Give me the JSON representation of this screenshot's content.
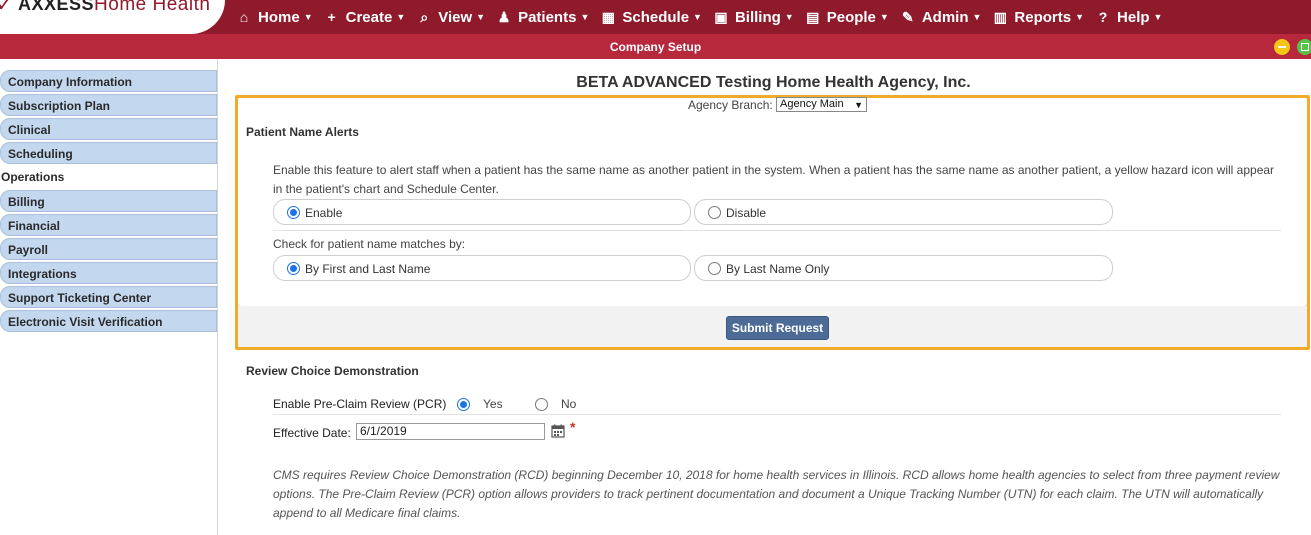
{
  "app": {
    "brand_bold": "AXXESS",
    "brand_light": "Home Health"
  },
  "nav": [
    {
      "label": "Home",
      "icon": "home-icon",
      "glyph": "⌂"
    },
    {
      "label": "Create",
      "icon": "plus-icon",
      "glyph": "+"
    },
    {
      "label": "View",
      "icon": "search-icon",
      "glyph": "⌕"
    },
    {
      "label": "Patients",
      "icon": "user-icon",
      "glyph": "♟"
    },
    {
      "label": "Schedule",
      "icon": "calendar-icon",
      "glyph": "▦"
    },
    {
      "label": "Billing",
      "icon": "money-icon",
      "glyph": "▣"
    },
    {
      "label": "People",
      "icon": "id-card-icon",
      "glyph": "▤"
    },
    {
      "label": "Admin",
      "icon": "wrench-icon",
      "glyph": "✎"
    },
    {
      "label": "Reports",
      "icon": "bar-chart-icon",
      "glyph": "▥"
    },
    {
      "label": "Help",
      "icon": "question-icon",
      "glyph": "?"
    }
  ],
  "window": {
    "title": "Company Setup"
  },
  "sidebar": {
    "items": [
      {
        "label": "Company Information",
        "active": false
      },
      {
        "label": "Subscription Plan",
        "active": false
      },
      {
        "label": "Clinical",
        "active": false
      },
      {
        "label": "Scheduling",
        "active": false
      },
      {
        "label": "Operations",
        "active": true
      },
      {
        "label": "Billing",
        "active": false
      },
      {
        "label": "Financial",
        "active": false
      },
      {
        "label": "Payroll",
        "active": false
      },
      {
        "label": "Integrations",
        "active": false
      },
      {
        "label": "Support Ticketing Center",
        "active": false
      },
      {
        "label": "Electronic Visit Verification",
        "active": false
      }
    ]
  },
  "main": {
    "agency_title": "BETA ADVANCED Testing Home Health Agency, Inc.",
    "branch_label": "Agency Branch:",
    "branch_value": "Agency Main",
    "patient_alerts": {
      "title": "Patient Name Alerts",
      "description_line1": "Enable this feature to alert staff when a patient has the same name as another patient in the system. When a patient has the same name as another patient, a yellow hazard icon will appear",
      "description_line2": "in the patient's chart and Schedule Center.",
      "enable_label": "Enable",
      "disable_label": "Disable",
      "enable_selected": true,
      "match_label": "Check for patient name matches by:",
      "first_last_label": "By First and Last Name",
      "last_only_label": "By Last Name Only",
      "first_last_selected": true
    },
    "submit_label": "Submit Request",
    "rcd": {
      "title": "Review Choice Demonstration",
      "pcr_label": "Enable Pre-Claim Review (PCR)",
      "yes_label": "Yes",
      "no_label": "No",
      "yes_selected": true,
      "effective_label": "Effective Date:",
      "effective_value": "6/1/2019",
      "required_mark": "*",
      "note_line1": "CMS requires Review Choice Demonstration (RCD) beginning December 10, 2018 for home health services in Illinois. RCD allows home health agencies to select from three payment review",
      "note_line2": "options. The Pre-Claim Review (PCR) option allows providers to track pertinent documentation and document a Unique Tracking Number (UTN) for each claim. The UTN will automatically",
      "note_line3": "append to all Medicare final claims."
    }
  },
  "colors": {
    "nav_bg": "#8f1a2c",
    "title_bg": "#b7283d",
    "sidebar_item_bg": "#c3d7ef",
    "highlight_border": "#f0ac29",
    "submit_bg": "#4d6b97",
    "radio_accent": "#1a73e8"
  }
}
